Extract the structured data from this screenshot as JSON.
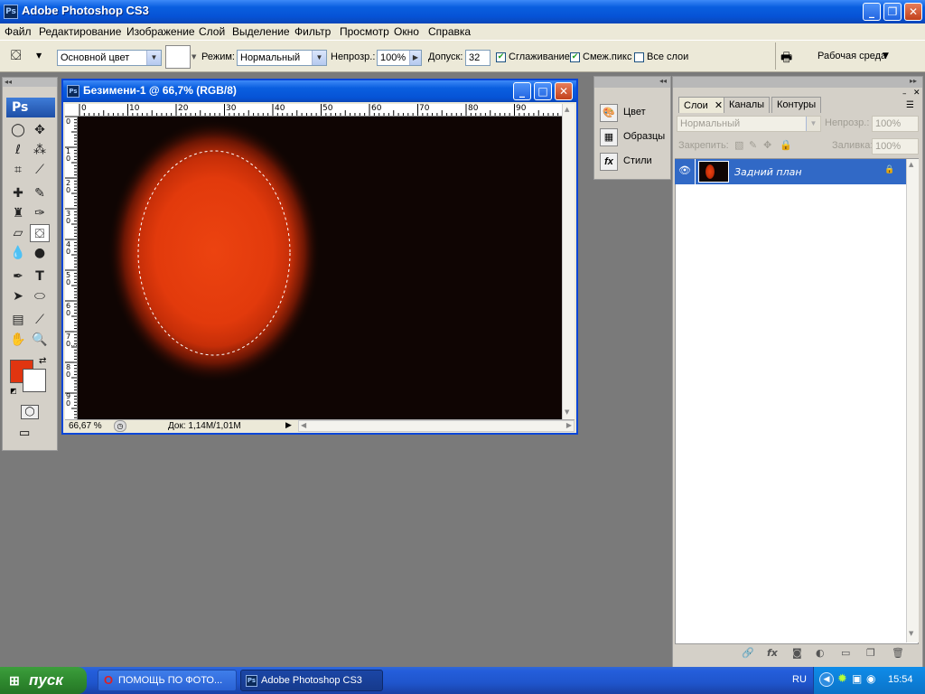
{
  "app": {
    "title": "Adobe Photoshop CS3",
    "icon_label": "Ps"
  },
  "menu": [
    "Файл",
    "Редактирование",
    "Изображение",
    "Слой",
    "Выделение",
    "Фильтр",
    "Просмотр",
    "Окно",
    "Справка"
  ],
  "options": {
    "fill_source": "Основной цвет",
    "mode_label": "Режим:",
    "mode_value": "Нормальный",
    "opacity_label": "Непрозр.:",
    "opacity_value": "100%",
    "tolerance_label": "Допуск:",
    "tolerance_value": "32",
    "antialias_label": "Сглаживание",
    "contiguous_label": "Смеж.пикс",
    "all_layers_label": "Все слои",
    "antialias_checked": true,
    "contiguous_checked": true,
    "all_layers_checked": false,
    "workspace_label": "Рабочая среда"
  },
  "toolbox": {
    "logo": "Ps",
    "foreground_color": "#e03510",
    "background_color": "#ffffff"
  },
  "document": {
    "title": "Безимени-1 @ 66,7% (RGB/8)",
    "zoom": "66,67 %",
    "doc_info": "Док: 1,14M/1,01M",
    "ruler_h_labels": [
      "0",
      "10",
      "20",
      "30",
      "40",
      "50",
      "60",
      "70",
      "80",
      "90"
    ],
    "ruler_v_labels": [
      "0",
      "1\n0",
      "2\n0",
      "3\n0",
      "4\n0",
      "5\n0",
      "6\n0",
      "7\n0...",
      "8\n0",
      "9\n0"
    ],
    "canvas_bg": "#0f0503",
    "glow_color": "#e63a0e"
  },
  "dock_panels": [
    "Цвет",
    "Образцы",
    "Стили"
  ],
  "layers_panel": {
    "tabs": [
      "Слои",
      "Каналы",
      "Контуры"
    ],
    "blend_mode": "Нормальный",
    "opacity_label": "Непрозр.:",
    "opacity_value": "100%",
    "lock_label": "Закрепить:",
    "fill_label": "Заливка:",
    "fill_value": "100%",
    "layer_name": "Задний план"
  },
  "taskbar": {
    "start_label": "пуск",
    "items": [
      "ПОМОЩЬ ПО ФОТО...",
      "Adobe Photoshop CS3"
    ],
    "language": "RU",
    "clock": "15:54"
  }
}
